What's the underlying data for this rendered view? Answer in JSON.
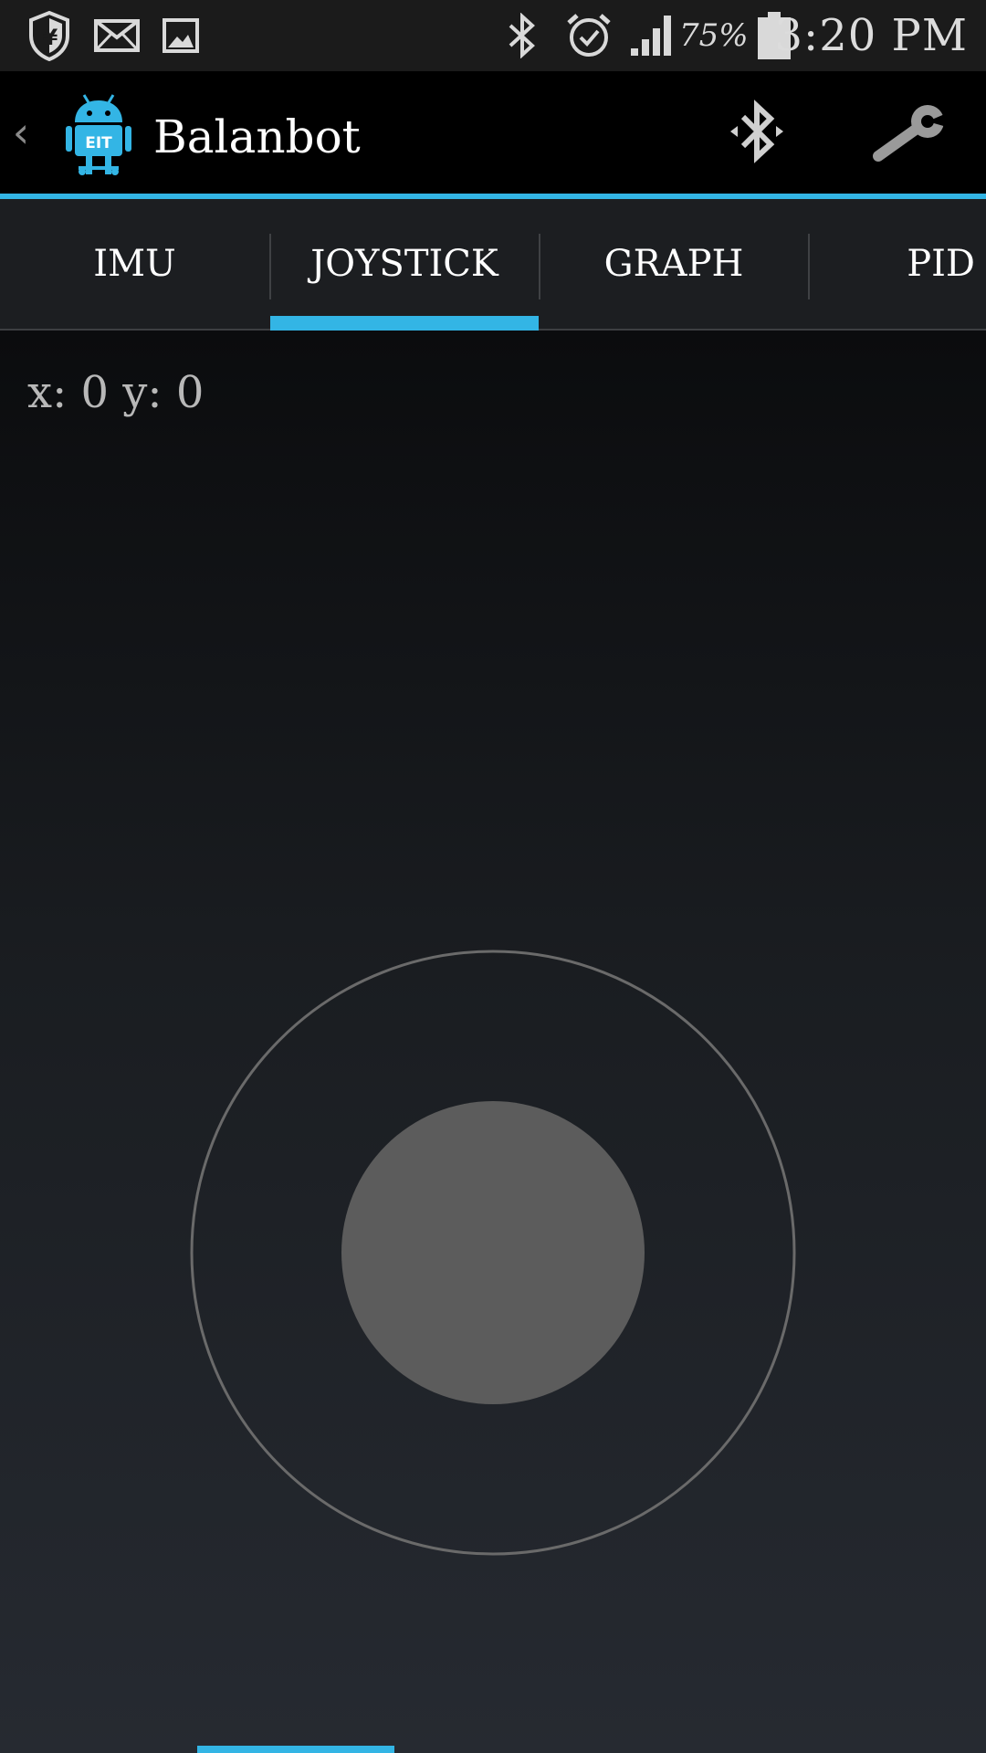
{
  "status_bar": {
    "icons": [
      "shield-yen-icon",
      "mail-icon",
      "gallery-icon",
      "bluetooth-icon",
      "alarm-icon",
      "signal-icon",
      "battery-icon"
    ],
    "battery_percent": "75%",
    "time": "3:20 PM"
  },
  "action_bar": {
    "up_caret": "‹",
    "title": "Balanbot",
    "app_icon_text": "EIT",
    "actions": [
      "bluetooth-connect-icon",
      "settings-wrench-icon"
    ]
  },
  "tabs": [
    {
      "label": "IMU",
      "selected": false
    },
    {
      "label": "JOYSTICK",
      "selected": true
    },
    {
      "label": "GRAPH",
      "selected": false
    },
    {
      "label": "PID",
      "selected": false
    }
  ],
  "joystick": {
    "readout": "x: 0 y: 0",
    "x": 0,
    "y": 0
  },
  "colors": {
    "accent": "#33b5e5",
    "knob": "#5c5c5c",
    "ring": "#6a6a6a"
  }
}
